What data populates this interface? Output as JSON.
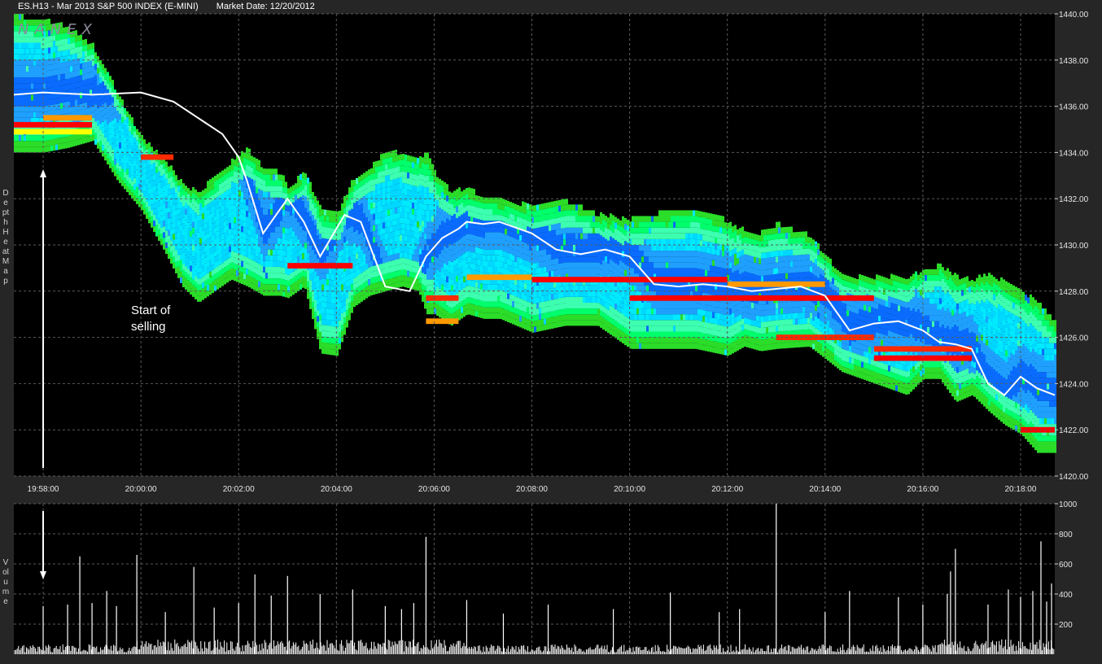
{
  "header": {
    "symbol_title": "ES.H13 - Mar 2013 S&P 500 INDEX (E-MINI)",
    "market_date": "Market Date: 12/20/2012"
  },
  "watermark": "NANEX",
  "side_labels": {
    "top": "Depth Heat Map",
    "bottom": "Volume"
  },
  "annotation": {
    "line1": "Start of",
    "line2": "selling"
  },
  "colors": {
    "background": "#000000",
    "grid": "#5a5a5a",
    "frame": "#262626",
    "price_line": "#ffffff"
  },
  "chart_data": [
    {
      "type": "heatmap",
      "title": "",
      "x_ticks": [
        "19:58:00",
        "20:00:00",
        "20:02:00",
        "20:04:00",
        "20:06:00",
        "20:08:00",
        "20:10:00",
        "20:12:00",
        "20:14:00",
        "20:16:00",
        "20:18:00"
      ],
      "y_ticks": [
        "1440.00",
        "1438.00",
        "1436.00",
        "1434.00",
        "1432.00",
        "1430.00",
        "1428.00",
        "1426.00",
        "1424.00",
        "1422.00",
        "1420.00"
      ],
      "ylim": [
        1420,
        1440
      ],
      "x_range_seconds_from_1958": [
        -36,
        1242
      ],
      "palette": [
        "#00d8ff",
        "#00eaff",
        "#1fa0ff",
        "#0a6cff",
        "#3cffb0",
        "#00ff6a",
        "#2bdc28",
        "#ffff00",
        "#ff9900",
        "#ff2a00",
        "#ff0000"
      ],
      "price_path": {
        "t_seconds": [
          -36,
          0,
          60,
          120,
          160,
          190,
          220,
          240,
          250,
          270,
          300,
          320,
          340,
          370,
          390,
          420,
          450,
          470,
          490,
          510,
          520,
          540,
          560,
          600,
          630,
          660,
          690,
          720,
          750,
          780,
          810,
          840,
          870,
          900,
          930,
          960,
          990,
          1020,
          1050,
          1080,
          1100,
          1120,
          1140,
          1160,
          1180,
          1200,
          1220,
          1242
        ],
        "price": [
          1436.5,
          1436.6,
          1436.5,
          1436.6,
          1436.2,
          1435.5,
          1434.8,
          1433.8,
          1432.8,
          1430.5,
          1432.0,
          1431.0,
          1429.5,
          1431.3,
          1431.0,
          1428.2,
          1428.0,
          1429.5,
          1430.3,
          1430.7,
          1431.0,
          1430.9,
          1431.0,
          1430.5,
          1429.8,
          1429.6,
          1429.8,
          1429.5,
          1428.3,
          1428.2,
          1428.3,
          1428.2,
          1428.0,
          1428.1,
          1428.2,
          1427.8,
          1426.3,
          1426.6,
          1426.7,
          1426.3,
          1425.8,
          1425.7,
          1425.5,
          1424.0,
          1423.5,
          1424.3,
          1423.8,
          1423.5
        ]
      },
      "envelope": {
        "t_seconds": [
          -36,
          0,
          30,
          60,
          90,
          120,
          150,
          170,
          190,
          210,
          230,
          250,
          270,
          290,
          300,
          320,
          340,
          360,
          380,
          400,
          420,
          440,
          460,
          470,
          480,
          500,
          520,
          540,
          560,
          600,
          640,
          680,
          720,
          760,
          800,
          840,
          860,
          880,
          900,
          940,
          980,
          1020,
          1060,
          1080,
          1100,
          1120,
          1140,
          1160,
          1180,
          1200,
          1220,
          1242
        ],
        "high": [
          1439.8,
          1439.6,
          1439.3,
          1438.5,
          1436.5,
          1434.5,
          1433.5,
          1432.5,
          1432.2,
          1432.8,
          1433.5,
          1434.0,
          1433.2,
          1433.0,
          1432.4,
          1433.0,
          1431.5,
          1431.2,
          1432.8,
          1433.2,
          1434.0,
          1433.8,
          1433.6,
          1433.8,
          1433.0,
          1432.2,
          1432.3,
          1432.0,
          1431.8,
          1431.6,
          1431.8,
          1431.2,
          1431.0,
          1431.3,
          1431.5,
          1430.9,
          1430.5,
          1430.4,
          1430.8,
          1430.3,
          1428.5,
          1428.5,
          1428.5,
          1428.8,
          1429.0,
          1428.5,
          1428.4,
          1428.6,
          1428.3,
          1427.8,
          1427.5,
          1426.5
        ],
        "low": [
          1434.0,
          1434.0,
          1434.2,
          1434.5,
          1432.8,
          1431.5,
          1429.6,
          1428.2,
          1427.5,
          1428.0,
          1428.5,
          1428.2,
          1427.8,
          1427.8,
          1427.7,
          1428.2,
          1425.3,
          1425.2,
          1427.3,
          1427.8,
          1428.0,
          1428.2,
          1428.0,
          1427.0,
          1427.0,
          1426.5,
          1427.0,
          1426.8,
          1426.8,
          1426.2,
          1426.5,
          1426.5,
          1425.5,
          1425.5,
          1425.5,
          1425.2,
          1425.6,
          1425.4,
          1425.5,
          1425.6,
          1424.5,
          1424.0,
          1423.5,
          1424.2,
          1424.2,
          1423.2,
          1423.5,
          1422.8,
          1422.2,
          1421.8,
          1421.0,
          1421.0
        ]
      },
      "walls": [
        {
          "from": -36,
          "to": 60,
          "price": 1435.2,
          "color": "#ff0000"
        },
        {
          "from": -36,
          "to": 60,
          "price": 1434.9,
          "color": "#ffff00"
        },
        {
          "from": 0,
          "to": 60,
          "price": 1435.5,
          "color": "#ff9900"
        },
        {
          "from": 120,
          "to": 160,
          "price": 1433.8,
          "color": "#ff2a00"
        },
        {
          "from": 300,
          "to": 380,
          "price": 1429.1,
          "color": "#ff0000"
        },
        {
          "from": 470,
          "to": 510,
          "price": 1427.7,
          "color": "#ff2a00"
        },
        {
          "from": 470,
          "to": 510,
          "price": 1426.7,
          "color": "#ff9900"
        },
        {
          "from": 520,
          "to": 600,
          "price": 1428.6,
          "color": "#ff9900"
        },
        {
          "from": 600,
          "to": 840,
          "price": 1428.5,
          "color": "#ff0000"
        },
        {
          "from": 720,
          "to": 1020,
          "price": 1427.7,
          "color": "#ff0000"
        },
        {
          "from": 840,
          "to": 960,
          "price": 1428.3,
          "color": "#ff9900"
        },
        {
          "from": 900,
          "to": 1020,
          "price": 1426.0,
          "color": "#ff2a00"
        },
        {
          "from": 1020,
          "to": 1140,
          "price": 1425.5,
          "color": "#ff2a00"
        },
        {
          "from": 1020,
          "to": 1140,
          "price": 1425.1,
          "color": "#ff0000"
        },
        {
          "from": 1200,
          "to": 1242,
          "price": 1422.0,
          "color": "#ff0000"
        }
      ]
    },
    {
      "type": "bar",
      "title": "",
      "ylabel": "Volume",
      "y_ticks": [
        "1000",
        "800",
        "600",
        "400",
        "200"
      ],
      "ylim": [
        0,
        1000
      ],
      "baseline_level": 60,
      "spikes": [
        {
          "t": 0,
          "v": 320
        },
        {
          "t": 30,
          "v": 330
        },
        {
          "t": 45,
          "v": 650
        },
        {
          "t": 60,
          "v": 340
        },
        {
          "t": 78,
          "v": 420
        },
        {
          "t": 90,
          "v": 320
        },
        {
          "t": 115,
          "v": 660
        },
        {
          "t": 150,
          "v": 280
        },
        {
          "t": 185,
          "v": 580
        },
        {
          "t": 210,
          "v": 310
        },
        {
          "t": 240,
          "v": 340
        },
        {
          "t": 260,
          "v": 530
        },
        {
          "t": 280,
          "v": 390
        },
        {
          "t": 300,
          "v": 520
        },
        {
          "t": 340,
          "v": 400
        },
        {
          "t": 380,
          "v": 430
        },
        {
          "t": 420,
          "v": 320
        },
        {
          "t": 440,
          "v": 300
        },
        {
          "t": 455,
          "v": 340
        },
        {
          "t": 470,
          "v": 780
        },
        {
          "t": 520,
          "v": 360
        },
        {
          "t": 565,
          "v": 270
        },
        {
          "t": 620,
          "v": 330
        },
        {
          "t": 700,
          "v": 300
        },
        {
          "t": 770,
          "v": 410
        },
        {
          "t": 830,
          "v": 280
        },
        {
          "t": 855,
          "v": 300
        },
        {
          "t": 900,
          "v": 1000
        },
        {
          "t": 960,
          "v": 280
        },
        {
          "t": 990,
          "v": 420
        },
        {
          "t": 1050,
          "v": 380
        },
        {
          "t": 1080,
          "v": 330
        },
        {
          "t": 1110,
          "v": 400
        },
        {
          "t": 1114,
          "v": 550
        },
        {
          "t": 1120,
          "v": 700
        },
        {
          "t": 1160,
          "v": 330
        },
        {
          "t": 1185,
          "v": 430
        },
        {
          "t": 1200,
          "v": 380
        },
        {
          "t": 1215,
          "v": 420
        },
        {
          "t": 1225,
          "v": 750
        },
        {
          "t": 1232,
          "v": 350
        },
        {
          "t": 1238,
          "v": 470
        }
      ]
    }
  ]
}
